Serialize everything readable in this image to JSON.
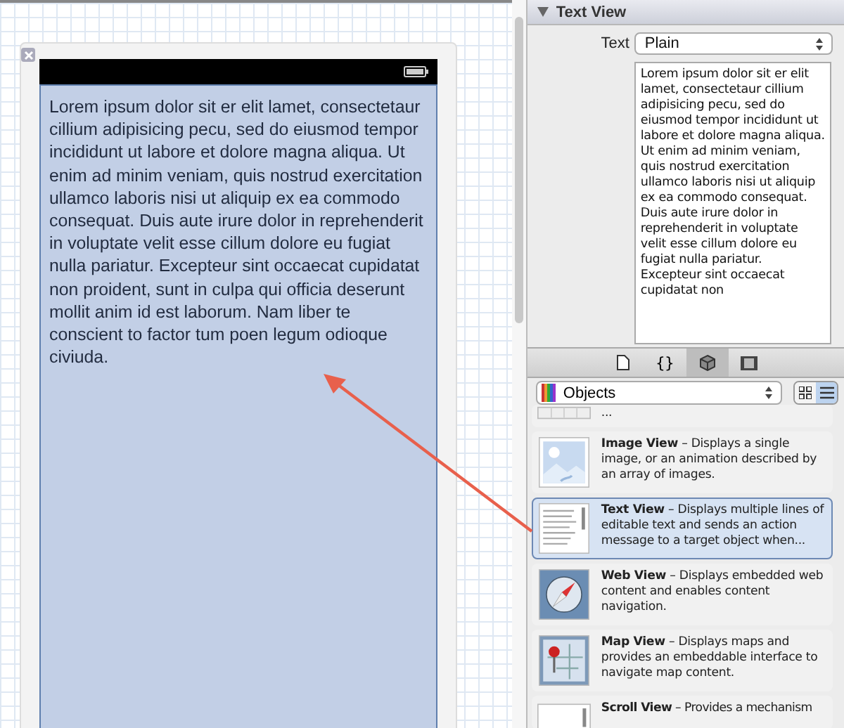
{
  "canvas": {
    "text_view": {
      "text": "Lorem ipsum dolor sit er elit lamet, consectetaur cillium adipisicing pecu, sed do eiusmod tempor incididunt ut labore et dolore magna aliqua. Ut enim ad minim veniam, quis nostrud exercitation ullamco laboris nisi ut aliquip ex ea commodo consequat. Duis aute irure dolor in reprehenderit in voluptate velit esse cillum dolore eu fugiat nulla pariatur. Excepteur sint occaecat cupidatat non proident, sunt in culpa qui officia deserunt mollit anim id est laborum. Nam liber te conscient to factor tum poen legum odioque civiuda.",
      "selected": true
    }
  },
  "inspector": {
    "section": {
      "title": "Text View",
      "expanded": true
    },
    "text_label": "Text",
    "text_type": "Plain",
    "text_value": "Lorem ipsum dolor sit er elit lamet, consectetaur cillium adipisicing pecu, sed do eiusmod tempor incididunt ut labore et dolore magna aliqua. Ut enim ad minim veniam, quis nostrud exercitation ullamco laboris nisi ut aliquip ex ea commodo consequat. Duis aute irure dolor in reprehenderit in voluptate velit esse cillum dolore eu fugiat nulla pariatur. Excepteur sint occaecat cupidatat non"
  },
  "library": {
    "tabs": [
      {
        "kind": "file",
        "selected": false
      },
      {
        "kind": "braces",
        "label": "{}",
        "selected": false
      },
      {
        "kind": "cube",
        "selected": true
      },
      {
        "kind": "film",
        "selected": false
      }
    ],
    "filter": "Objects",
    "view_modes": [
      {
        "kind": "grid",
        "selected": false
      },
      {
        "kind": "list",
        "selected": true
      }
    ],
    "items": [
      {
        "kind": "partial",
        "description": "...",
        "selected": false
      },
      {
        "kind": "image",
        "title": "Image View",
        "description": "– Displays a single image, or an animation described by an array of images.",
        "selected": false
      },
      {
        "kind": "text",
        "title": "Text View",
        "description": "– Displays multiple lines of editable text and sends an action message to a target object when...",
        "selected": true
      },
      {
        "kind": "web",
        "title": "Web View",
        "description": "– Displays embedded web content and enables content navigation.",
        "selected": false
      },
      {
        "kind": "map",
        "title": "Map View",
        "description": "– Displays maps and provides an embeddable interface to navigate map content.",
        "selected": false
      },
      {
        "kind": "scroll",
        "title": "Scroll View",
        "description": "– Provides a mechanism",
        "selected": false
      }
    ]
  }
}
